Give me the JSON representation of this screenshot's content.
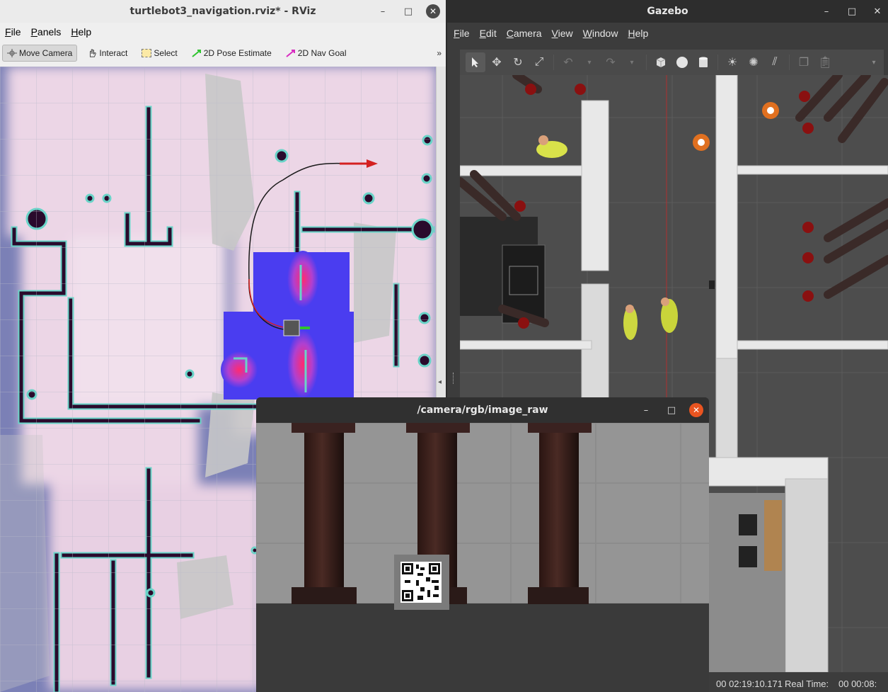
{
  "rviz": {
    "title": "turtlebot3_navigation.rviz* - RViz",
    "menu": [
      "File",
      "Panels",
      "Help"
    ],
    "tools": [
      {
        "label": "Move Camera",
        "icon": "move-camera-icon",
        "active": true
      },
      {
        "label": "Interact",
        "icon": "hand-icon",
        "active": false
      },
      {
        "label": "Select",
        "icon": "select-box-icon",
        "active": false
      },
      {
        "label": "2D Pose Estimate",
        "icon": "green-arrow-icon",
        "active": false
      },
      {
        "label": "2D Nav Goal",
        "icon": "magenta-arrow-icon",
        "active": false
      }
    ],
    "overflow": "»",
    "collapse": "◂"
  },
  "gazebo": {
    "title": "Gazebo",
    "menu": [
      "File",
      "Edit",
      "Camera",
      "View",
      "Window",
      "Help"
    ],
    "tools": [
      "select-arrow-icon",
      "translate-icon",
      "rotate-icon",
      "scale-icon",
      "undo-icon",
      "redo-icon",
      "box-icon",
      "sphere-icon",
      "cylinder-icon",
      "sun-light-icon",
      "point-light-icon",
      "spot-light-icon",
      "copy-icon",
      "paste-icon"
    ],
    "status": {
      "sim_time_value": "00 02:19:10.171",
      "real_time_label": "Real Time:",
      "real_time_value": "00 00:08:"
    }
  },
  "camera": {
    "title": "/camera/rgb/image_raw"
  },
  "window_controls": {
    "minimize": "–",
    "maximize": "□",
    "close": "✕"
  },
  "colors": {
    "costmap_bg": "#ecd6e6",
    "costmap_low": "#7b80b6",
    "obstacle": "#2a0a2c",
    "inflation": "#69d4c8",
    "local_costmap": "#4a3df0",
    "path": "#1a1a1a",
    "goal_arrow": "#d42020",
    "orange": "#e95420"
  }
}
